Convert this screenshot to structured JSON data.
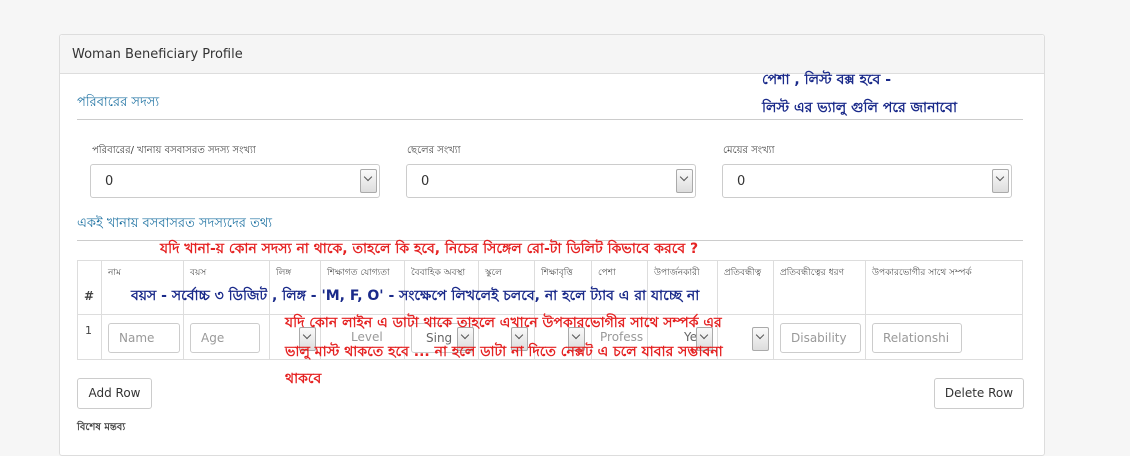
{
  "panel": {
    "title": "Woman Beneficiary Profile"
  },
  "section1": {
    "title": "পরিবারের সদস্য"
  },
  "fields": {
    "members_label": "পরিবারের/ খানায় বসবাসরত সদস্য সংখ্যা",
    "members_value": "0",
    "sons_label": "ছেলের সংখ্যা",
    "sons_value": "0",
    "daughters_label": "মেয়ের সংখ্যা",
    "daughters_value": "0"
  },
  "section2": {
    "title": "একই খানায় বসবাসরত সদস্যদের তথ্য"
  },
  "table": {
    "headers": [
      "#",
      "নাম",
      "বয়স",
      "লিঙ্গ",
      "শিক্ষাগত যোগ্যতা",
      "বৈবাহিক অবস্থা",
      "স্কুলে",
      "শিক্ষাবৃত্তি",
      "পেশা",
      "উপার্জনকারী",
      "প্রতিবন্ধীত্ব",
      "প্রতিবন্ধীত্বের ধরণ",
      "উপকারভোগীর সাথে সম্পর্ক"
    ],
    "row": {
      "num": "1",
      "name_ph": "Name",
      "age_ph": "Age",
      "level_ph": "Level",
      "marital": "Sing",
      "profession_ph": "Profess",
      "earner": "Ye",
      "disability_ph": "Disability",
      "relation_ph": "Relationshi"
    }
  },
  "buttons": {
    "add_row": "Add Row",
    "delete_row": "Delete Row"
  },
  "footer": {
    "label": "বিশেষ মন্তব্য"
  },
  "annotations": {
    "note1_line1": "পেশা , লিস্ট বক্স হবে -",
    "note1_line2": "লিস্ট এর ভ্যালু গুলি পরে জানাবো",
    "note2": "যদি খানা-য় কোন সদস্য না থাকে, তাহলে কি হবে, নিচের সিঙ্গেল রো-টা ডিলিট কিভাবে করবে ?",
    "note3": "বয়স - সর্বোচ্চ ৩ ডিজিট , লিঙ্গ - 'M, F, O' - সংক্ষেপে লিখলেই চলবে, না হলে ট্যাব এ রা যাচ্ছে না",
    "note4_line1": "যদি কোন লাইন এ ডাটা থাকে তাহলে এখানে উপকারভোগীর সাথে সম্পর্ক এর",
    "note4_line2": "ভালু মাস্ট থাকতে হবে ... না হলে ডাটা না দিতে নেক্সট এ চলে যাবার সম্ভাবনা",
    "note4_line3": "থাকবে"
  },
  "colors": {
    "section_title": "#1a6fa0",
    "note_red": "#e52222",
    "note_blue": "#1a2a8a"
  },
  "icons": [
    "chevron-down-icon"
  ]
}
